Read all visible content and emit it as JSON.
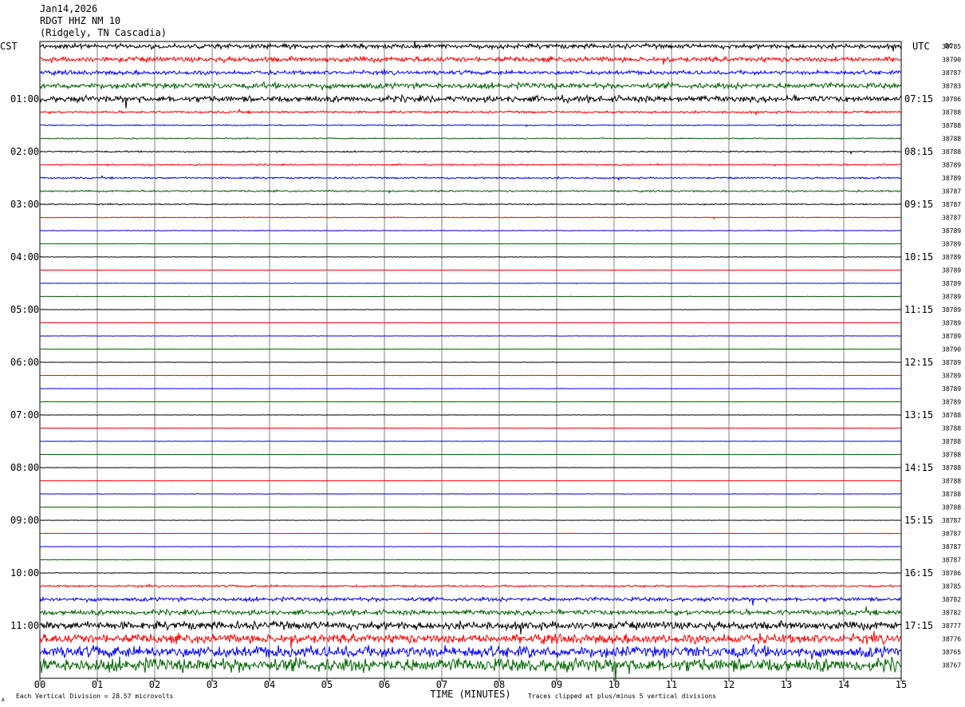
{
  "header": {
    "date": "Jan14,2026",
    "station": "RDGT HHZ NM 10",
    "location": "(Ridgely, TN Cascadia)"
  },
  "chart_data": {
    "type": "line",
    "left_timezone": "CST",
    "right_timezone": "UTC",
    "dc_label": "DC",
    "xlabel": "TIME (MINUTES)",
    "xlim": [
      0,
      15
    ],
    "x_ticks": [
      "00",
      "01",
      "02",
      "03",
      "04",
      "05",
      "06",
      "07",
      "08",
      "09",
      "10",
      "11",
      "12",
      "13",
      "14",
      "15"
    ],
    "left_hour_labels": [
      "01:00",
      "02:00",
      "03:00",
      "04:00",
      "05:00",
      "06:00",
      "07:00",
      "08:00",
      "09:00",
      "10:00",
      "11:00"
    ],
    "right_hour_labels": [
      "07:15",
      "08:15",
      "09:15",
      "10:15",
      "11:15",
      "12:15",
      "13:15",
      "14:15",
      "15:15",
      "16:15",
      "17:15"
    ],
    "dc_values": [
      "38785",
      "38790",
      "38787",
      "38783",
      "38786",
      "38788",
      "38788",
      "38788",
      "38788",
      "38789",
      "38789",
      "38787",
      "38787",
      "38787",
      "38789",
      "38789",
      "38789",
      "38789",
      "38789",
      "38789",
      "38789",
      "38789",
      "38789",
      "38790",
      "38789",
      "38789",
      "38789",
      "38789",
      "38788",
      "38788",
      "38788",
      "38788",
      "38788",
      "38788",
      "38788",
      "38788",
      "38787",
      "38787",
      "38787",
      "38787",
      "38786",
      "38785",
      "38782",
      "38782",
      "38777",
      "38776",
      "38765",
      "38767"
    ],
    "trace_colors": [
      "#000000",
      "#ff0000",
      "#0000ff",
      "#006400"
    ],
    "trace_amplitude_levels": [
      4,
      4.5,
      3.5,
      5,
      5.5,
      2,
      1,
      1,
      1.2,
      1.4,
      1.5,
      1.5,
      1,
      0.8,
      0.6,
      0.4,
      0.4,
      0.35,
      0.35,
      0.3,
      0.35,
      0.35,
      0.3,
      0.3,
      0.3,
      0.3,
      0.3,
      0.3,
      0.3,
      0.3,
      0.3,
      0.3,
      0.3,
      0.3,
      0.4,
      0.3,
      0.3,
      0.3,
      0.35,
      0.4,
      0.5,
      1.8,
      3.5,
      4.5,
      7,
      8,
      10,
      12
    ],
    "footer_left": "Each Vertical Division =   28.57 microvolts",
    "footer_right": "Traces clipped at plus/minus 5 vertical divisions",
    "corner_mark": "A",
    "grid": true
  }
}
